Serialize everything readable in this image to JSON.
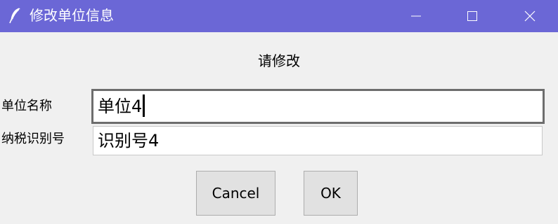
{
  "window": {
    "title": "修改单位信息",
    "title_bar_color": "#6b67d6",
    "icons": {
      "app": "feather-icon",
      "minimize": "minimize-icon",
      "maximize": "maximize-icon",
      "close": "close-icon"
    }
  },
  "dialog": {
    "prompt": "请修改",
    "fields": {
      "name": {
        "label": "单位名称",
        "value": "单位4"
      },
      "tax_id": {
        "label": "纳税识别号",
        "value": "识别号4"
      }
    },
    "buttons": {
      "cancel": "Cancel",
      "ok": "OK"
    }
  }
}
